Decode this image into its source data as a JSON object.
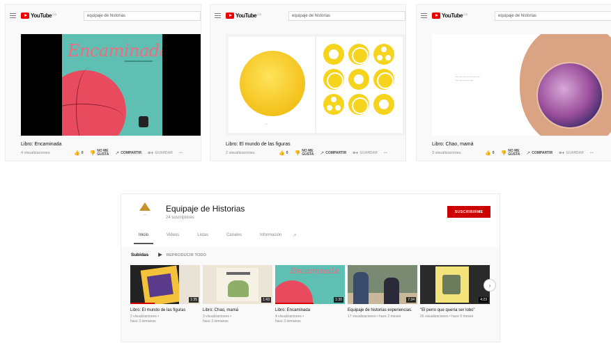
{
  "youtube": {
    "logo_text": "YouTube",
    "search_query": "equipaje de historias"
  },
  "panels": [
    {
      "title": "Libro: Encaminada",
      "views": "4 visualizaciones",
      "likes": "0",
      "dislike_label_1": "NO ME",
      "dislike_label_2": "GUSTA",
      "share_label": "COMPARTIR",
      "save_label": "GUARDAR",
      "cover_title": "Encaminada"
    },
    {
      "title": "Libro: El mundo de las figuras",
      "views": "2 visualizaciones",
      "likes": "0",
      "dislike_label_1": "NO ME",
      "dislike_label_2": "GUSTA",
      "share_label": "COMPARTIR",
      "save_label": "GUARDAR"
    },
    {
      "title": "Libro: Chao, mamá",
      "views": "3 visualizaciones",
      "likes": "0",
      "dislike_label_1": "NO ME",
      "dislike_label_2": "GUSTA",
      "share_label": "COMPARTIR",
      "save_label": "GUARDAR"
    }
  ],
  "channel": {
    "name": "Equipaje de Historias",
    "subscribers": "24 suscriptores",
    "subscribe_label": "SUSCRIBIRME",
    "tabs": [
      "Inicio",
      "Videos",
      "Listas",
      "Canales",
      "Información"
    ],
    "active_tab": "Inicio",
    "section_title": "Subidas",
    "play_all_label": "REPRODUCIR TODO",
    "videos": [
      {
        "title": "Libro: El mundo de las figuras",
        "meta1": "2 visualizaciones •",
        "meta2": "hace 3 semanas",
        "duration": "1:35",
        "progress": 0.35
      },
      {
        "title": "Libro: Chao, mamá",
        "meta1": "3 visualizaciones •",
        "meta2": "hace 3 semanas",
        "duration": "1:43",
        "progress": 0.0
      },
      {
        "title": "Libro: Encaminada",
        "meta1": "4 visualizaciones •",
        "meta2": "hace 3 semanas",
        "duration": "1:30",
        "progress": 0.55
      },
      {
        "title": "Equipaje de historias experiencias.",
        "meta1": "17 visualizaciones • hace 2 meses",
        "meta2": "",
        "duration": "7:34",
        "progress": 0.0
      },
      {
        "title": "\"El perro que quería ser lobo\"",
        "meta1": "26 visualizaciones • hace 5 meses",
        "meta2": "",
        "duration": "4:23",
        "progress": 0.0
      }
    ]
  }
}
